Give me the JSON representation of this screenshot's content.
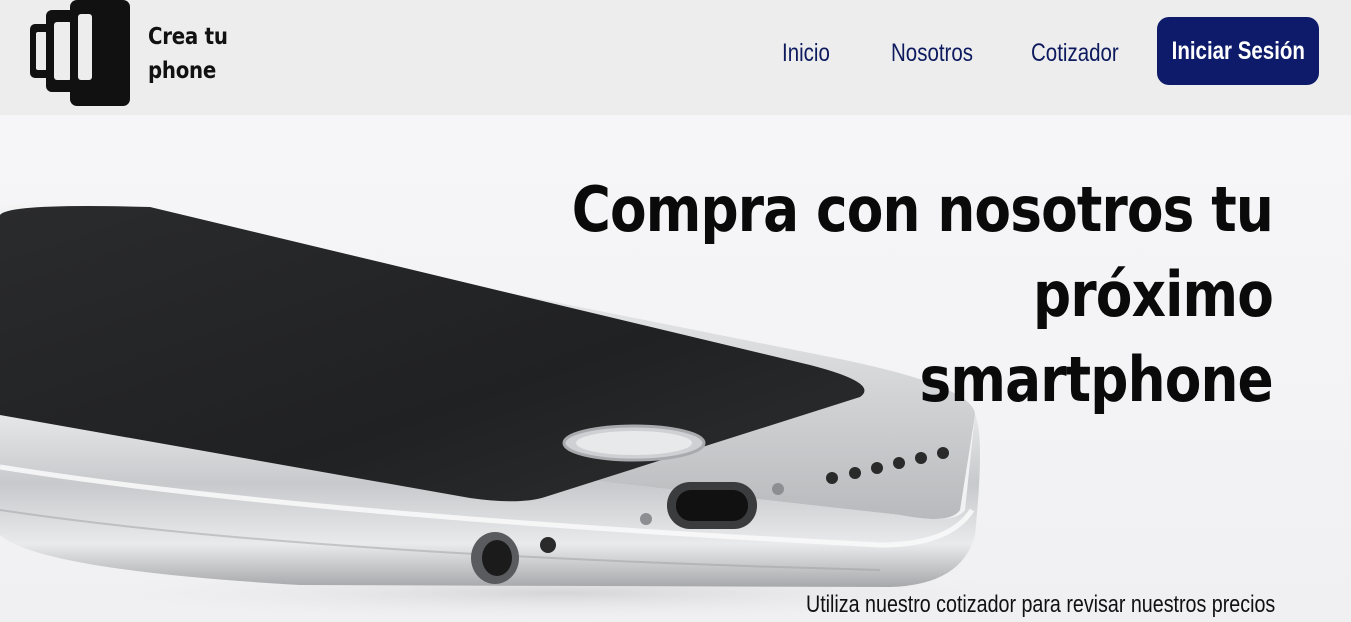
{
  "header": {
    "brand_line1": "Crea tu",
    "brand_line2": "phone",
    "nav": [
      {
        "label": "Inicio"
      },
      {
        "label": "Nosotros"
      },
      {
        "label": "Cotizador"
      }
    ],
    "login_label": "Iniciar Sesión"
  },
  "hero": {
    "title_line1": "Compra con nosotros tu próximo",
    "title_line2": "smartphone",
    "subtitle": "Utiliza nuestro cotizador para revisar nuestros precios"
  },
  "colors": {
    "nav_text": "#0d1b5e",
    "button_bg": "#0d1b6a",
    "header_bg": "#ededee"
  },
  "icons": {
    "logo": "phones-logo-icon"
  }
}
